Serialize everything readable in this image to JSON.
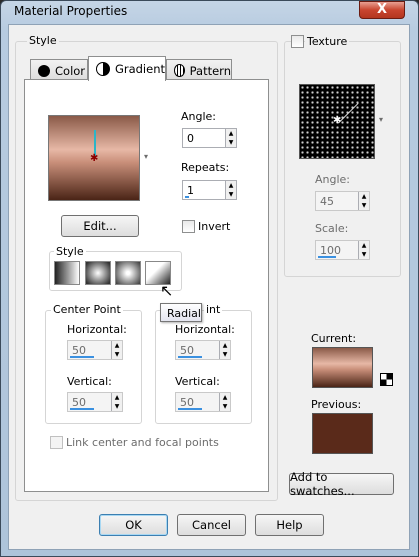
{
  "window": {
    "title": "Material Properties",
    "close_glyph": "X"
  },
  "style_group": {
    "label": "Style"
  },
  "tabs": [
    {
      "label": "Color",
      "icon": "color-circle-icon"
    },
    {
      "label": "Gradient",
      "icon": "gradient-circle-icon"
    },
    {
      "label": "Pattern",
      "icon": "pattern-globe-icon"
    }
  ],
  "gradient": {
    "angle_label": "Angle:",
    "angle_value": "0",
    "repeats_label": "Repeats:",
    "repeats_value": "1",
    "edit_button": "Edit...",
    "invert_label": "Invert",
    "style_label": "Style",
    "tooltip": "Radial",
    "center_point": {
      "label": "Center Point",
      "h_label": "Horizontal:",
      "h_value": "50",
      "v_label": "Vertical:",
      "v_value": "50"
    },
    "focal_point": {
      "label_tail": "int",
      "h_label": "Horizontal:",
      "h_value": "50",
      "v_label": "Vertical:",
      "v_value": "50"
    },
    "link_label": "Link center and focal points"
  },
  "texture": {
    "label": "Texture",
    "angle_label": "Angle:",
    "angle_value": "45",
    "scale_label": "Scale:",
    "scale_value": "100"
  },
  "preview": {
    "current_label": "Current:",
    "previous_label": "Previous:",
    "add_button": "Add to swatches..."
  },
  "footer": {
    "ok": "OK",
    "cancel": "Cancel",
    "help": "Help"
  },
  "colors": {
    "gradient_light": "#e7b8a6",
    "gradient_dark": "#4a2416",
    "previous": "#5a2a1a"
  }
}
